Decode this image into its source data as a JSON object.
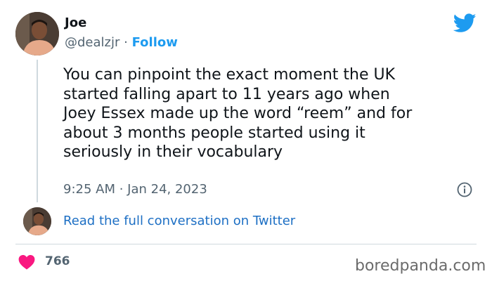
{
  "author": {
    "name": "Joe",
    "handle": "@dealzjr",
    "separator": "·",
    "follow_label": "Follow"
  },
  "tweet": {
    "text": "You can pinpoint the exact moment the UK\nstarted falling apart to 11 years ago when\nJoey Essex made up the word “reem” and for\nabout 3 months people started using it\nseriously in their vocabulary",
    "timestamp": "9:25 AM · Jan 24, 2023"
  },
  "conversation_link": "Read the full conversation on Twitter",
  "engagement": {
    "like_count": "766"
  },
  "watermark": "boredpanda.com",
  "colors": {
    "accent": "#1d9bf0",
    "link": "#1d6fc4",
    "heart": "#f91880",
    "muted": "#536471"
  },
  "icons": {
    "brand": "twitter-bird-icon",
    "info": "info-icon",
    "like": "heart-icon"
  }
}
